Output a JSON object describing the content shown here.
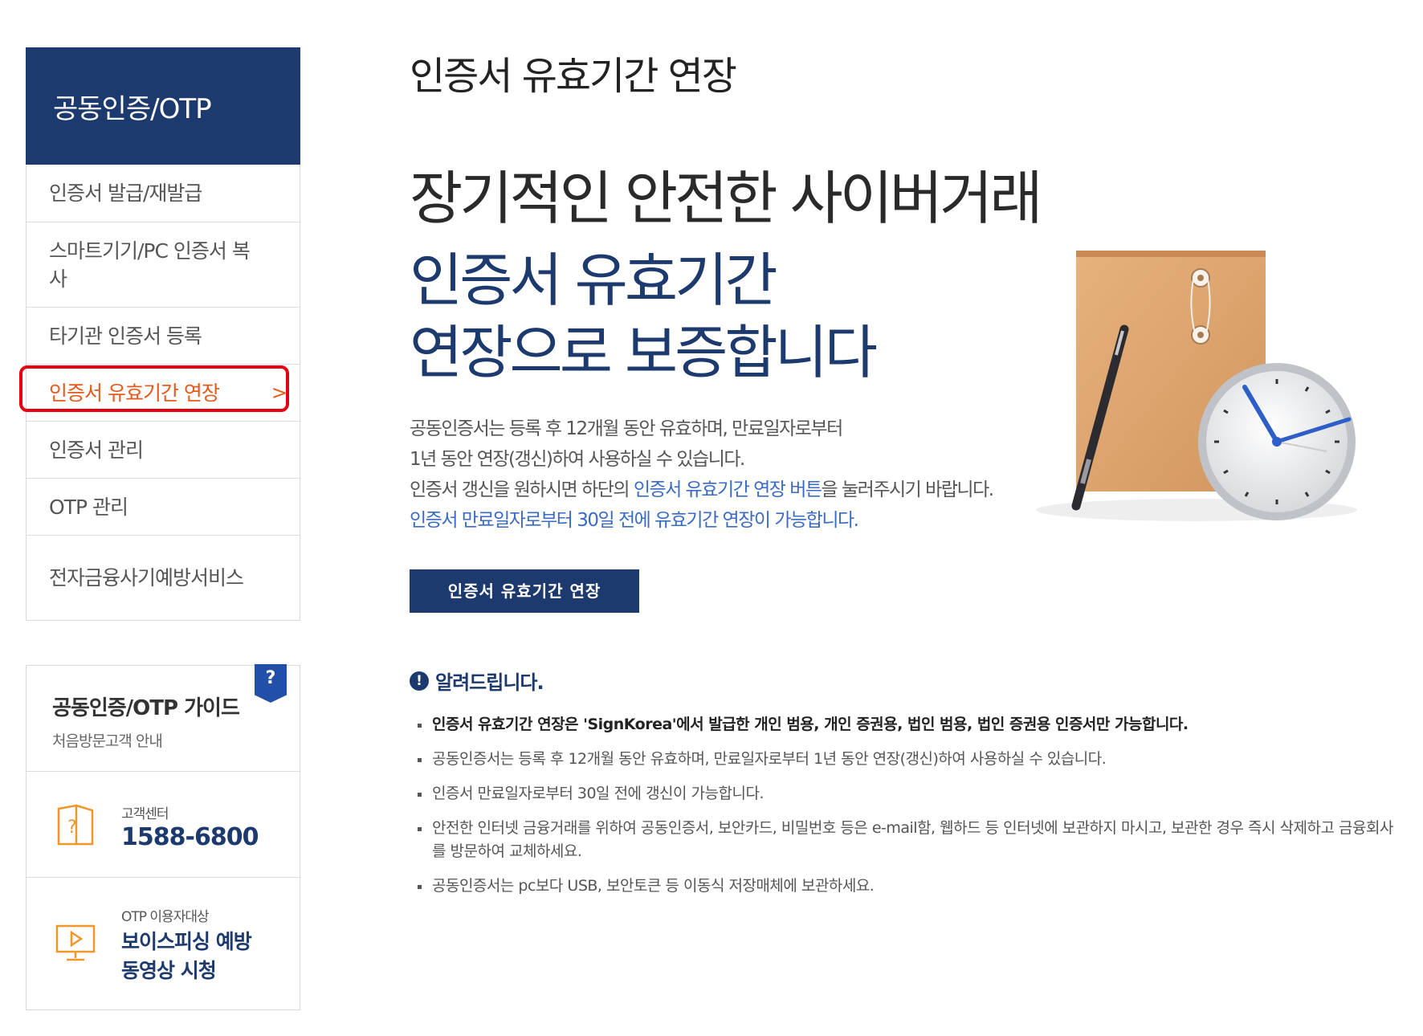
{
  "sidebar": {
    "title": "공동인증/OTP",
    "items": [
      {
        "label": "인증서 발급/재발급"
      },
      {
        "label": "스마트기기/PC 인증서 복사"
      },
      {
        "label": "타기관 인증서 등록"
      },
      {
        "label": "인증서 유효기간 연장",
        "chevron": ">"
      },
      {
        "label": "인증서 관리"
      },
      {
        "label": "OTP 관리"
      },
      {
        "label": "전자금융사기예방서비스"
      }
    ]
  },
  "guide": {
    "title": "공동인증/OTP 가이드",
    "subtitle": "처음방문고객 안내",
    "badge": "?",
    "support_label": "고객센터",
    "support_phone": "1588-6800",
    "video_label": "OTP 이용자대상",
    "video_title_line1": "보이스피싱 예방",
    "video_title_line2": "동영상 시청"
  },
  "main": {
    "page_title": "인증서 유효기간 연장",
    "hero_line1": "장기적인 안전한 사이버거래",
    "hero_line2": "인증서 유효기간",
    "hero_line3": "연장으로 보증합니다",
    "desc_line1": "공동인증서는 등록 후 12개월 동안 유효하며, 만료일자로부터",
    "desc_line2": "1년 동안 연장(갱신)하여 사용하실 수 있습니다.",
    "desc_line3_a": "인증서 갱신을 원하시면 하단의 ",
    "desc_line3_b": "인증서 유효기간 연장 버튼",
    "desc_line3_c": "을 눌러주시기 바랍니다.",
    "desc_line4": "인증서 만료일자로부터 30일 전에 유효기간 연장이 가능합니다.",
    "cta_label": "인증서 유효기간 연장"
  },
  "notice": {
    "title": "알려드립니다.",
    "icon": "!",
    "items": [
      "인증서 유효기간 연장은 'SignKorea'에서 발급한 개인 범용, 개인 증권용, 법인 범용, 법인 증권용 인증서만 가능합니다.",
      "공동인증서는 등록 후 12개월 동안 유효하며, 만료일자로부터 1년 동안 연장(갱신)하여 사용하실 수 있습니다.",
      "인증서 만료일자로부터 30일 전에 갱신이 가능합니다.",
      "안전한 인터넷 금융거래를 위하여 공동인증서, 보안카드, 비밀번호 등은 e-mail함, 웹하드 등 인터넷에 보관하지 마시고, 보관한 경우 즉시 삭제하고 금융회사를 방문하여 교체하세요.",
      "공동인증서는 pc보다 USB, 보안토큰 등 이동식 저장매체에 보관하세요."
    ]
  },
  "colors": {
    "navy": "#1d3a6e",
    "accent": "#e55a1c",
    "highlight": "#e60012",
    "link_blue": "#3a6bc4"
  }
}
